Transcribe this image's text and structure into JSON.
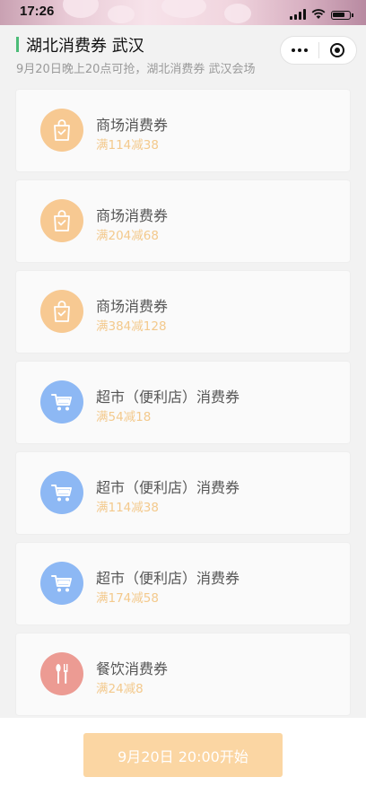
{
  "status_bar": {
    "time": "17:26",
    "icons": [
      "signal-icon",
      "wifi-icon",
      "battery-icon"
    ]
  },
  "header": {
    "title": "湖北消费券 武汉",
    "subtitle": "9月20日晚上20点可抢，湖北消费券 武汉会场",
    "accent_color": "#4cbc78",
    "capsule_icons": [
      "more-icon",
      "close-target-icon"
    ]
  },
  "coupons": [
    {
      "name": "商场消费券",
      "rule": "满114减38",
      "icon": "shopping-bag-icon",
      "color": "#f7c992"
    },
    {
      "name": "商场消费券",
      "rule": "满204减68",
      "icon": "shopping-bag-icon",
      "color": "#f7c992"
    },
    {
      "name": "商场消费券",
      "rule": "满384减128",
      "icon": "shopping-bag-icon",
      "color": "#f7c992"
    },
    {
      "name": "超市（便利店）消费券",
      "rule": "满54减18",
      "icon": "shopping-cart-icon",
      "color": "#8db8f4"
    },
    {
      "name": "超市（便利店）消费券",
      "rule": "满114减38",
      "icon": "shopping-cart-icon",
      "color": "#8db8f4"
    },
    {
      "name": "超市（便利店）消费券",
      "rule": "满174减58",
      "icon": "shopping-cart-icon",
      "color": "#8db8f4"
    },
    {
      "name": "餐饮消费券",
      "rule": "满24减8",
      "icon": "utensils-icon",
      "color": "#ec9b93"
    }
  ],
  "footer": {
    "start_label": "9月20日 20:00开始",
    "button_color": "#fbd6a3"
  }
}
